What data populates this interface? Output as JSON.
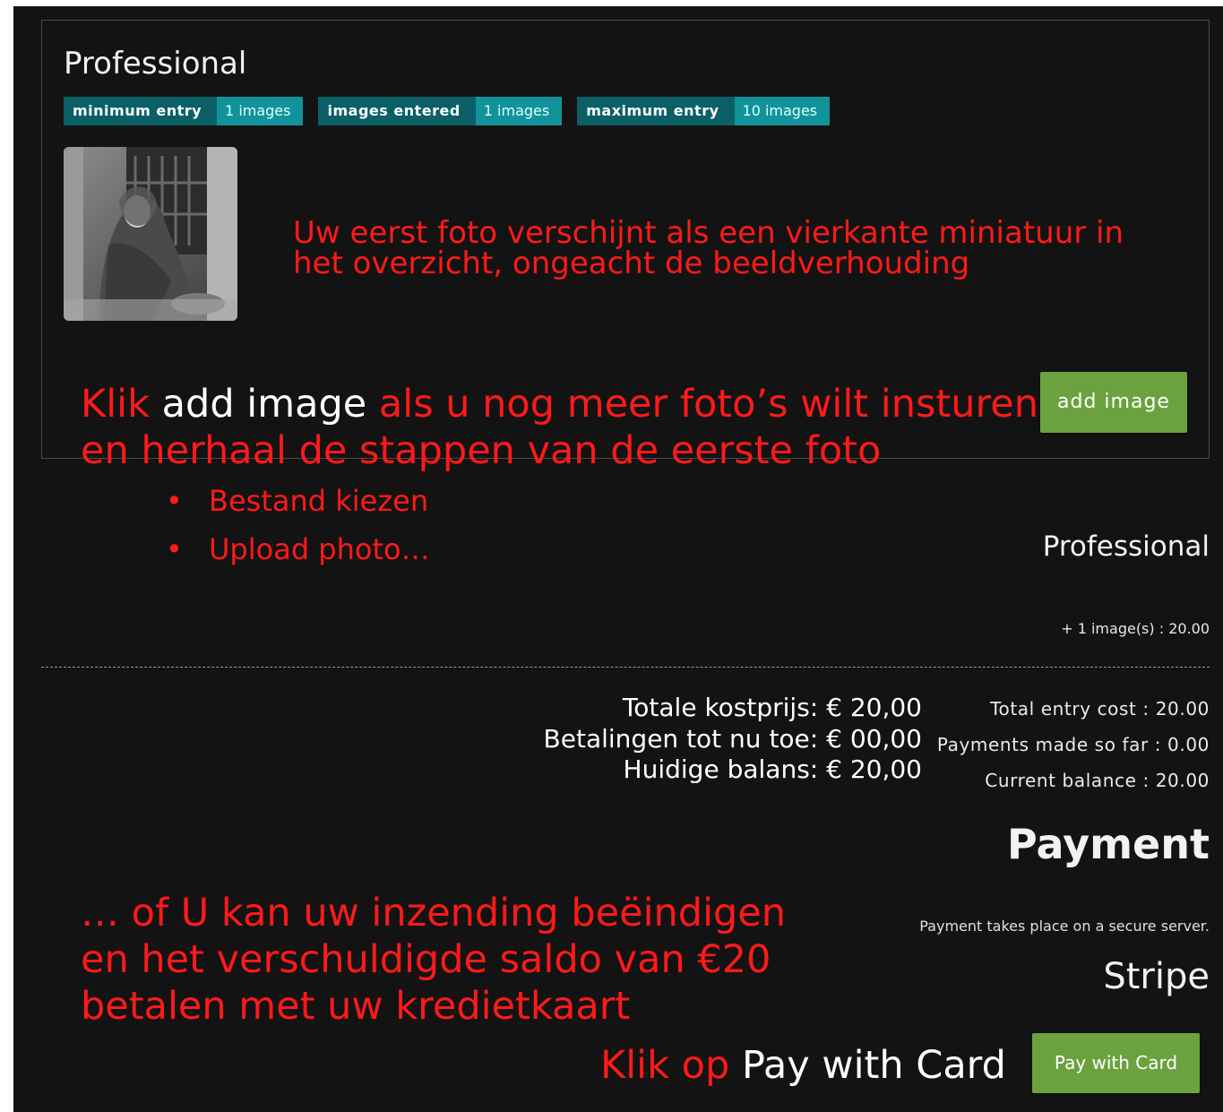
{
  "entry": {
    "category_title": "Professional",
    "badges": [
      {
        "key": "minimum entry",
        "value": "1 images"
      },
      {
        "key": "images entered",
        "value": "1 images"
      },
      {
        "key": "maximum entry",
        "value": "10 images"
      }
    ],
    "add_button_label": "add image"
  },
  "annotations": {
    "thumb_note_line1": "Uw eerst foto verschijnt als een vierkante miniatuur in",
    "thumb_note_line2": "het overzicht, ongeacht de beeldverhouding",
    "add_note_klik": "Klik",
    "add_note_button": "add image",
    "add_note_rest1": "als u nog meer foto’s wilt insturen",
    "add_note_line2": "en herhaal de stappen van de eerste foto",
    "bullets": [
      "Bestand kiezen",
      "Upload photo…"
    ],
    "finish_note_line1": "… of U kan uw inzending beëindigen",
    "finish_note_line2": "en het verschuldigde saldo van €20",
    "finish_note_line3": "betalen met uw kredietkaart",
    "pay_note_klik": "Klik op",
    "pay_note_button": "Pay with Card",
    "totals_nl": [
      "Totale kostprijs: € 20,00",
      "Betalingen tot nu toe: € 00,00",
      "Huidige balans: € 20,00"
    ]
  },
  "summary": {
    "category_title": "Professional",
    "line_item": "+ 1 image(s) : 20.00",
    "totals": [
      "Total entry cost : 20.00",
      "Payments made so far : 0.00",
      "Current balance : 20.00"
    ]
  },
  "payment": {
    "heading": "Payment",
    "secure_text": "Payment takes place on a secure server.",
    "provider_heading": "Stripe",
    "pay_button_label": "Pay with Card"
  },
  "colors": {
    "background": "#131313",
    "annotation_red": "#ff1a1a",
    "badge_key": "#0b5f67",
    "badge_value": "#12939b",
    "button_green": "#6ba23f"
  },
  "icons": {
    "bullet": "•"
  }
}
